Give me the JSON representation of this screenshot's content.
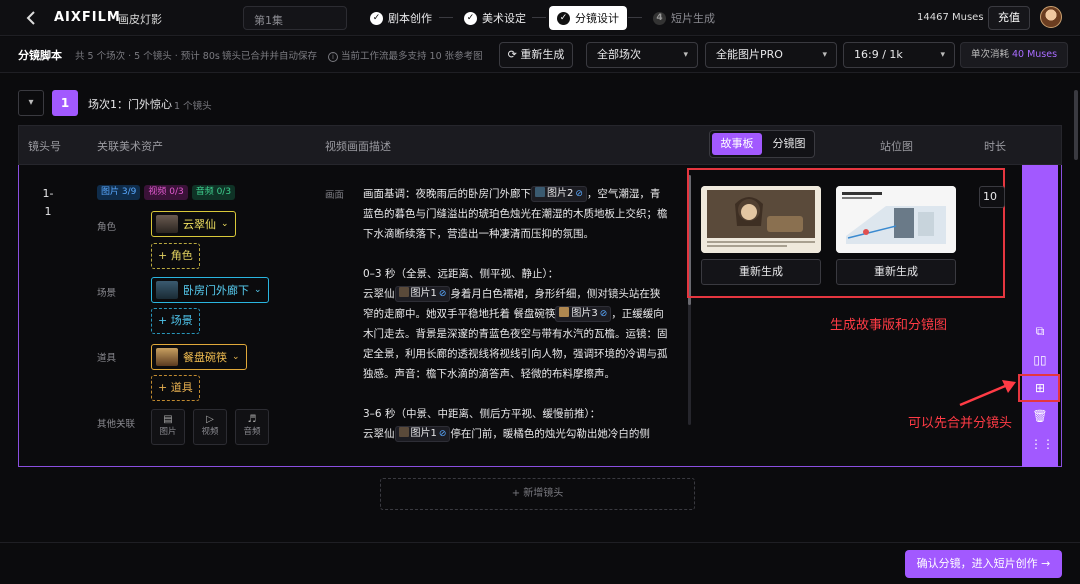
{
  "topbar": {
    "back_icon": "chevron-left-icon",
    "logo": "AIXFILM",
    "project_name": "画皮灯影",
    "episode": "第1集",
    "steps": [
      {
        "label": "剧本创作",
        "state": "done"
      },
      {
        "label": "美术设定",
        "state": "done"
      },
      {
        "label": "分镜设计",
        "state": "active"
      },
      {
        "label": "短片生成",
        "state": "todo",
        "index": "4"
      }
    ],
    "muses": "14467 Muses",
    "recharge": "充值"
  },
  "toolbar": {
    "title": "分镜脚本",
    "meta": "共 5 个场次 · 5 个镜头 · 预计 80s",
    "autosave": "镜头已合并并自动保存",
    "info": "当前工作流最多支持 10 张参考图",
    "regen_label": "重新生成",
    "scene_filter": "全部场次",
    "model": "全能图片PRO",
    "ratio": "16:9 / 1k",
    "cost_prefix": "单次消耗",
    "cost_value": "40 Muses"
  },
  "scene": {
    "number": "1",
    "title": "场次1：门外惊心",
    "count": "1 个镜头"
  },
  "table": {
    "headers": {
      "shot": "镜头号",
      "assets": "关联美术资产",
      "desc": "视频画面描述",
      "position": "站位图",
      "duration": "时长"
    },
    "view_tabs": [
      "故事板",
      "分镜图"
    ]
  },
  "shot": {
    "number_line1": "1-",
    "number_line2": "1",
    "badges": {
      "image": "图片 3/9",
      "video": "视频 0/3",
      "audio": "音频 0/3"
    },
    "role_label": "角色",
    "role_chip": "云翠仙",
    "add_role": "+ 角色",
    "scene_label": "场景",
    "scene_chip": "卧房门外廊下",
    "add_scene": "+ 场景",
    "prop_label": "道具",
    "prop_chip": "餐盘碗筷",
    "add_prop": "+ 道具",
    "other_label": "其他关联",
    "other_items": [
      "图片",
      "视频",
      "音频"
    ],
    "desc_label": "画面",
    "desc": {
      "p1_a": "画面基调：夜晚雨后的卧房门外廊下",
      "p1_ref": "图片2",
      "p1_b": "，空气潮湿，青蓝色的暮色与门缝溢出的琥珀色烛光在潮湿的木质地板上交织；檐下水滴断续落下，营造出一种凄清而压抑的氛围。",
      "p2_head": "0–3 秒（全景、远距离、侧平视、静止）：",
      "p2_a": "云翠仙",
      "p2_ref1": "图片1",
      "p2_b": "身着月白色襦裙，身形纤细，侧对镜头站在狭窄的走廊中。她双手平稳地托着 餐盘碗筷",
      "p2_ref2": "图片3",
      "p2_c": "，正缓缓向木门走去。背景是深邃的青蓝色夜空与带有水汽的瓦檐。运镜：固定全景，利用长廊的透视线将视线引向人物，强调环境的冷调与孤独感。声音：檐下水滴的滴答声、轻微的布料摩擦声。",
      "p3_head": "3–6 秒（中景、中距离、侧后方平视、缓慢前推）：",
      "p3_a": "云翠仙",
      "p3_ref": "图片1",
      "p3_b": "停在门前，暖橘色的烛光勾勒出她冷白的侧"
    },
    "storyboard_regen": "重新生成",
    "shotimage_regen": "重新生成",
    "duration": "10"
  },
  "annotations": {
    "generate": "生成故事版和分镜图",
    "merge": "可以先合并分镜头"
  },
  "side_tools": [
    "copy-icon",
    "split-icon",
    "merge-icon",
    "trash-icon",
    "drag-handle-icon"
  ],
  "add_shot": "+ 新增镜头",
  "confirm": "确认分镜，进入短片创作",
  "colors": {
    "accent": "#a259ff",
    "highlight": "#e5363f"
  }
}
